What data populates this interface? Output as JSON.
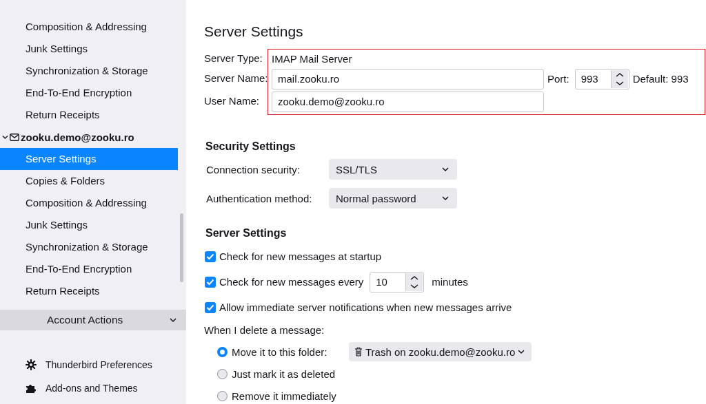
{
  "sidebar": {
    "items": [
      {
        "label": "Composition & Addressing",
        "selected": false
      },
      {
        "label": "Junk Settings",
        "selected": false
      },
      {
        "label": "Synchronization & Storage",
        "selected": false
      },
      {
        "label": "End-To-End Encryption",
        "selected": false
      },
      {
        "label": "Return Receipts",
        "selected": false
      }
    ],
    "account": {
      "label": "zooku.demo@zooku.ro",
      "expanded": true,
      "items": [
        {
          "label": "Server Settings",
          "selected": true
        },
        {
          "label": "Copies & Folders",
          "selected": false
        },
        {
          "label": "Composition & Addressing",
          "selected": false
        },
        {
          "label": "Junk Settings",
          "selected": false
        },
        {
          "label": "Synchronization & Storage",
          "selected": false
        },
        {
          "label": "End-To-End Encryption",
          "selected": false
        },
        {
          "label": "Return Receipts",
          "selected": false
        }
      ]
    },
    "account_actions": {
      "label": "Account Actions"
    },
    "footer": [
      {
        "kind": "gear",
        "label": "Thunderbird Preferences"
      },
      {
        "kind": "puzzle",
        "label": "Add-ons and Themes"
      }
    ]
  },
  "main": {
    "title": "Server Settings",
    "server": {
      "highlighted": true,
      "server_type": {
        "label": "Server Type:",
        "value": "IMAP Mail Server"
      },
      "server_name": {
        "label": "Server Name:",
        "value": "mail.zooku.ro"
      },
      "port": {
        "label": "Port:",
        "value": "993",
        "default": "Default: 993"
      },
      "user_name": {
        "label": "User Name:",
        "value": "zooku.demo@zooku.ro"
      }
    },
    "security": {
      "heading": "Security Settings",
      "rows": [
        {
          "label": "Connection security:",
          "value": "SSL/TLS"
        },
        {
          "label": "Authentication method:",
          "value": "Normal password"
        }
      ]
    },
    "server_settings": {
      "heading": "Server Settings",
      "checks": [
        {
          "kind": "plain",
          "label": "Check for new messages at startup",
          "checked": true
        },
        {
          "kind": "interval",
          "label": "Check for new messages every",
          "value": "10",
          "suffix": "minutes",
          "checked": true
        },
        {
          "kind": "plain",
          "label": "Allow immediate server notifications when new messages arrive",
          "checked": true
        }
      ],
      "delete_label": "When I delete a message:",
      "delete_options": [
        {
          "label": "Move it to this folder:",
          "selected": true,
          "folder": "Trash on zooku.demo@zooku.ro"
        },
        {
          "label": "Just mark it as deleted",
          "selected": false
        },
        {
          "label": "Remove it immediately",
          "selected": false
        }
      ]
    }
  }
}
